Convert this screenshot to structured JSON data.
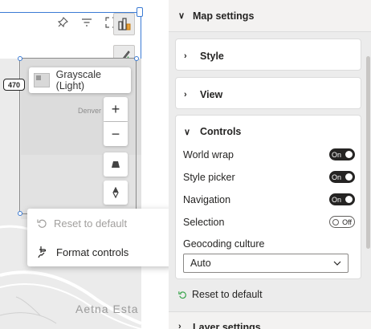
{
  "visual": {
    "road_badge": "470",
    "style_picker_label": "Grayscale (Light)",
    "map_labels": {
      "denver": "Denver",
      "aetna": "Aetna Esta"
    },
    "zoom_in": "+",
    "zoom_out": "−"
  },
  "context_menu": {
    "reset_label": "Reset to default",
    "format_label": "Format controls"
  },
  "pane": {
    "map_settings_label": "Map settings",
    "style_label": "Style",
    "view_label": "View",
    "controls_label": "Controls",
    "controls": [
      {
        "label": "World wrap",
        "state": "On"
      },
      {
        "label": "Style picker",
        "state": "On"
      },
      {
        "label": "Navigation",
        "state": "On"
      },
      {
        "label": "Selection",
        "state": "Off"
      }
    ],
    "geocoding_label": "Geocoding culture",
    "geocoding_value": "Auto",
    "reset_label": "Reset to default",
    "layer_settings_label": "Layer settings"
  },
  "colors": {
    "accent": "#3b7bd4",
    "toggle_on": "#252423"
  }
}
